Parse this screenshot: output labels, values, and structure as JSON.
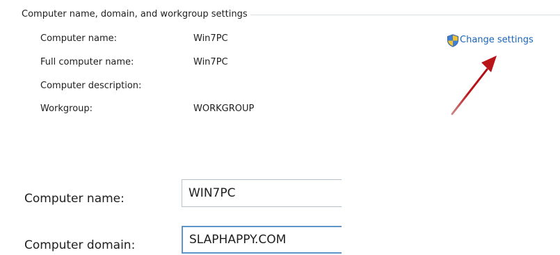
{
  "group": {
    "title": "Computer name, domain, and workgroup settings",
    "rows": [
      {
        "label": "Computer name:",
        "value": "Win7PC"
      },
      {
        "label": "Full computer name:",
        "value": "Win7PC"
      },
      {
        "label": "Computer description:",
        "value": ""
      },
      {
        "label": "Workgroup:",
        "value": "WORKGROUP"
      }
    ],
    "change_settings": {
      "label": "Change settings",
      "icon": "uac-shield-icon"
    }
  },
  "annotation": {
    "icon": "red-arrow-icon",
    "color": "#c0161c"
  },
  "dialog": {
    "computer_name": {
      "label": "Computer name:",
      "value": "WIN7PC"
    },
    "computer_domain": {
      "label": "Computer domain:",
      "value": "SLAPHAPPY.COM"
    }
  },
  "colors": {
    "link": "#1a63b8",
    "group_line": "#d5dfe5",
    "focus_border": "#5d94c9"
  }
}
